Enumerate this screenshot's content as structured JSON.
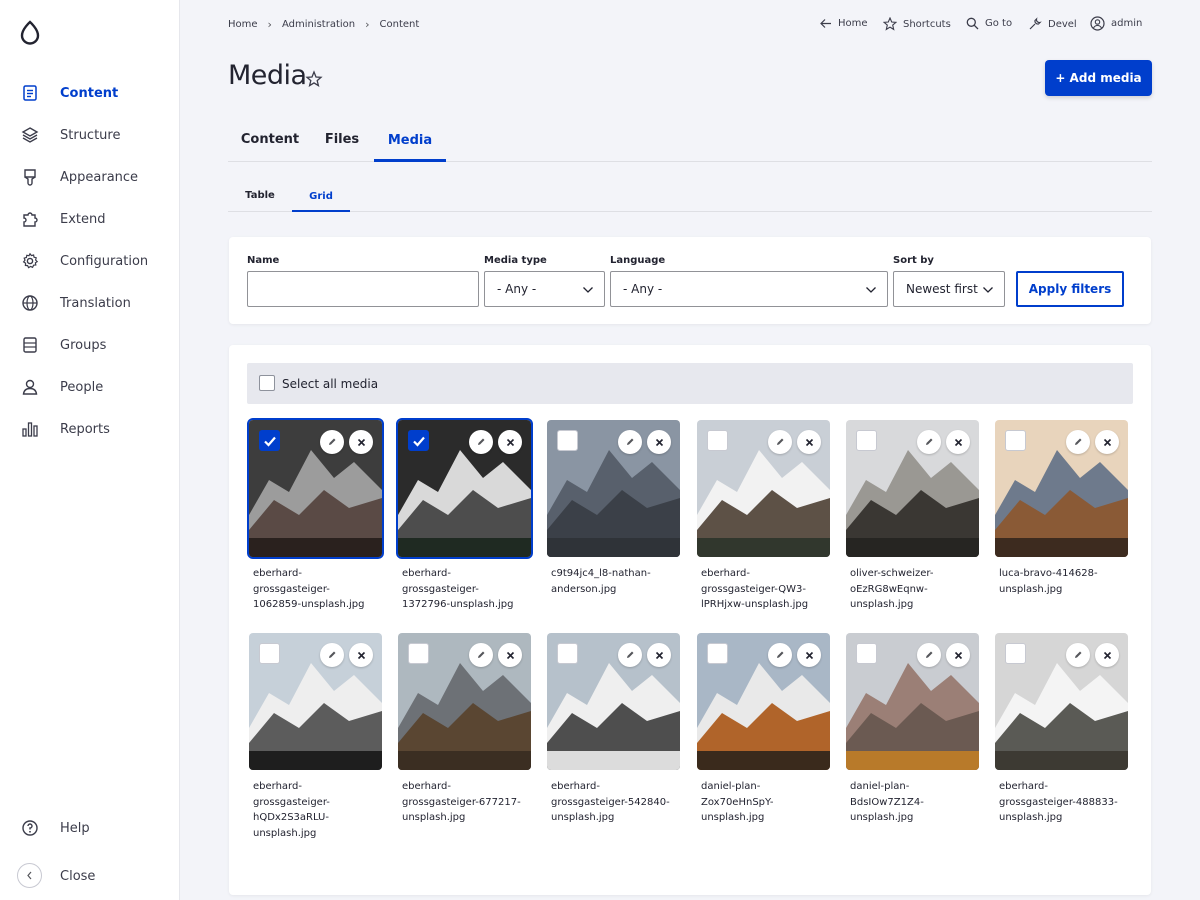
{
  "sidebar": {
    "items": [
      {
        "label": "Content",
        "icon": "document-icon",
        "active": true
      },
      {
        "label": "Structure",
        "icon": "layers-icon"
      },
      {
        "label": "Appearance",
        "icon": "paint-brush-icon"
      },
      {
        "label": "Extend",
        "icon": "puzzle-icon"
      },
      {
        "label": "Configuration",
        "icon": "gear-icon"
      },
      {
        "label": "Translation",
        "icon": "globe-icon"
      },
      {
        "label": "Groups",
        "icon": "list-icon"
      },
      {
        "label": "People",
        "icon": "person-icon"
      },
      {
        "label": "Reports",
        "icon": "bar-chart-icon"
      }
    ],
    "help_label": "Help",
    "close_label": "Close"
  },
  "breadcrumb": [
    "Home",
    "Administration",
    "Content"
  ],
  "toolbar": {
    "home": "Home",
    "shortcuts": "Shortcuts",
    "goto": "Go to",
    "devel": "Devel",
    "user": "admin"
  },
  "page": {
    "title": "Media",
    "add_button": "+ Add media"
  },
  "primary_tabs": [
    "Content",
    "Files",
    "Media"
  ],
  "secondary_tabs": [
    "Table",
    "Grid"
  ],
  "filters": {
    "name_label": "Name",
    "name_value": "",
    "media_type_label": "Media type",
    "media_type_value": "- Any -",
    "language_label": "Language",
    "language_value": "- Any -",
    "sort_label": "Sort by",
    "sort_value": "Newest first",
    "apply_label": "Apply filters"
  },
  "select_all_label": "Select all media",
  "media": [
    {
      "name": "eberhard-grossgasteiger-1062859-unsplash.jpg",
      "lines": [
        "eberhard-",
        "grossgasteiger-",
        "1062859-unsplash.jpg"
      ],
      "checked": true
    },
    {
      "name": "eberhard-grossgasteiger-1372796-unsplash.jpg",
      "lines": [
        "eberhard-",
        "grossgasteiger-",
        "1372796-unsplash.jpg"
      ],
      "checked": true
    },
    {
      "name": "c9t94jc4_l8-nathan-anderson.jpg",
      "lines": [
        "c9t94jc4_l8-nathan-",
        "anderson.jpg"
      ],
      "checked": false
    },
    {
      "name": "eberhard-grossgasteiger-QW3-lPRHjxw-unsplash.jpg",
      "lines": [
        "eberhard-",
        "grossgasteiger-QW3-",
        "lPRHjxw-unsplash.jpg"
      ],
      "checked": false
    },
    {
      "name": "oliver-schweizer-oEzRG8wEqnw-unsplash.jpg",
      "lines": [
        "oliver-schweizer-",
        "oEzRG8wEqnw-",
        "unsplash.jpg"
      ],
      "checked": false
    },
    {
      "name": "luca-bravo-414628-unsplash.jpg",
      "lines": [
        "luca-bravo-414628-",
        "unsplash.jpg"
      ],
      "checked": false
    },
    {
      "name": "eberhard-grossgasteiger-hQDx2S3aRLU-unsplash.jpg",
      "lines": [
        "eberhard-",
        "grossgasteiger-",
        "hQDx2S3aRLU-",
        "unsplash.jpg"
      ],
      "checked": false
    },
    {
      "name": "eberhard-grossgasteiger-677217-unsplash.jpg",
      "lines": [
        "eberhard-",
        "grossgasteiger-677217-",
        "unsplash.jpg"
      ],
      "checked": false
    },
    {
      "name": "eberhard-grossgasteiger-542840-unsplash.jpg",
      "lines": [
        "eberhard-",
        "grossgasteiger-542840-",
        "unsplash.jpg"
      ],
      "checked": false
    },
    {
      "name": "daniel-plan-Zox70eHnSpY-unsplash.jpg",
      "lines": [
        "daniel-plan-",
        "Zox70eHnSpY-",
        "unsplash.jpg"
      ],
      "checked": false
    },
    {
      "name": "daniel-plan-BdsIOw7Z1Z4-unsplash.jpg",
      "lines": [
        "daniel-plan-",
        "BdsIOw7Z1Z4-",
        "unsplash.jpg"
      ],
      "checked": false
    },
    {
      "name": "eberhard-grossgasteiger-488833-unsplash.jpg",
      "lines": [
        "eberhard-",
        "grossgasteiger-488833-",
        "unsplash.jpg"
      ],
      "checked": false
    }
  ],
  "colors": {
    "accent": "#003ecc",
    "sidebar_bg": "#ffffff",
    "page_bg": "#f3f4f9"
  }
}
